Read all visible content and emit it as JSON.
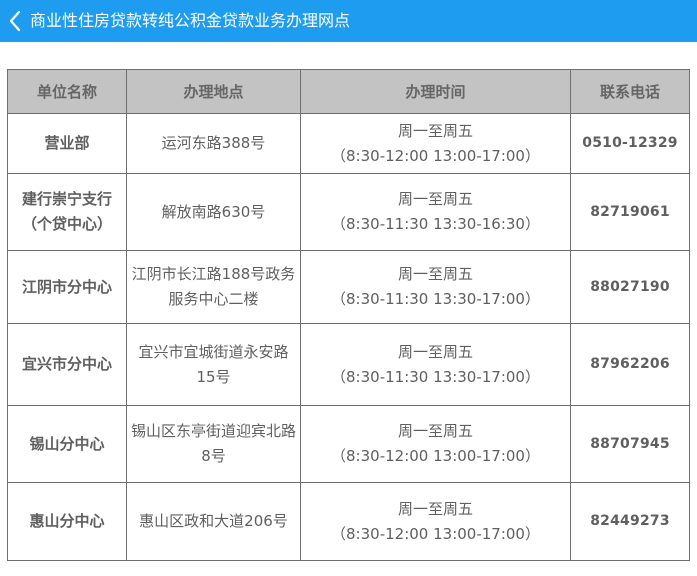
{
  "header": {
    "title": "商业性住房贷款转纯公积金贷款业务办理网点",
    "back_icon": "chevron-left-icon",
    "bg_color": "#1e9cf0"
  },
  "table": {
    "columns": [
      "单位名称",
      "办理地点",
      "办理时间",
      "联系电话"
    ],
    "rows": [
      {
        "name": [
          "营业部"
        ],
        "address": "运河东路388号",
        "time": [
          "周一至周五",
          "（8:30-12:00 13:00-17:00）"
        ],
        "phone": "0510-12329"
      },
      {
        "name": [
          "建行崇宁支行",
          "（个贷中心）"
        ],
        "address": "解放南路630号",
        "time": [
          "周一至周五",
          "（8:30-11:30 13:30-16:30）"
        ],
        "phone": "82719061"
      },
      {
        "name": [
          "江阴市分中心"
        ],
        "address": "江阴市长江路188号政务服务中心二楼",
        "time": [
          "周一至周五",
          "（8:30-11:30 13:30-17:00）"
        ],
        "phone": "88027190"
      },
      {
        "name": [
          "宜兴市分中心"
        ],
        "address": "宜兴市宜城街道永安路15号",
        "time": [
          "周一至周五",
          "（8:30-11:30 13:30-17:00）"
        ],
        "phone": "87962206"
      },
      {
        "name": [
          "锡山分中心"
        ],
        "address": "锡山区东亭街道迎宾北路8号",
        "time": [
          "周一至周五",
          "（8:30-12:00 13:00-17:00）"
        ],
        "phone": "88707945"
      },
      {
        "name": [
          "惠山分中心"
        ],
        "address": "惠山区政和大道206号",
        "time": [
          "周一至周五",
          "（8:30-12:00 13:00-17:00）"
        ],
        "phone": "82449273"
      }
    ]
  }
}
